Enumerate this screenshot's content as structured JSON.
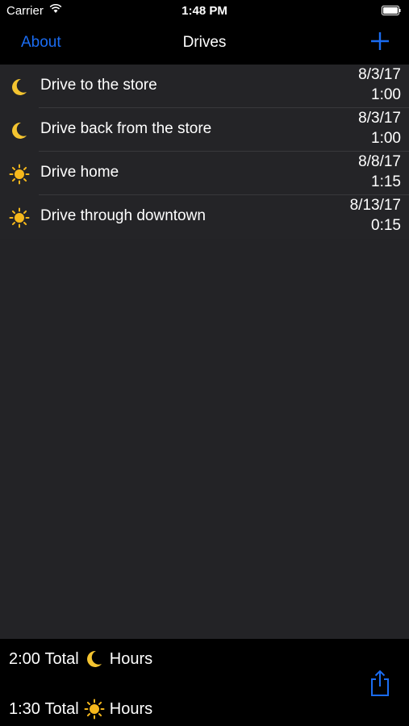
{
  "status_bar": {
    "carrier": "Carrier",
    "time": "1:48 PM"
  },
  "nav": {
    "back_label": "About",
    "title": "Drives"
  },
  "drives": [
    {
      "icon": "moon-icon",
      "title": "Drive to the store",
      "date": "8/3/17",
      "duration": "1:00"
    },
    {
      "icon": "moon-icon",
      "title": "Drive back from the store",
      "date": "8/3/17",
      "duration": "1:00"
    },
    {
      "icon": "sun-icon",
      "title": "Drive home",
      "date": "8/8/17",
      "duration": "1:15"
    },
    {
      "icon": "sun-icon",
      "title": "Drive through downtown",
      "date": "8/13/17",
      "duration": "0:15"
    }
  ],
  "totals": {
    "night": {
      "value": "2:00",
      "label_total": "Total",
      "label_hours": "Hours",
      "icon": "moon-icon"
    },
    "day": {
      "value": "1:30",
      "label_total": "Total",
      "label_hours": "Hours",
      "icon": "sun-icon"
    }
  },
  "colors": {
    "accent": "#1a6cf2",
    "list_bg": "#242427",
    "bar_bg": "#000000",
    "moon": "#f4c430",
    "sun": "#f6b81c"
  }
}
